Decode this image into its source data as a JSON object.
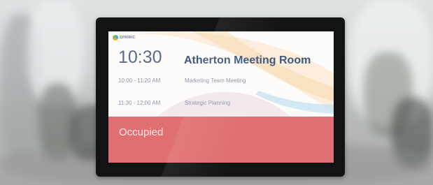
{
  "logo": {
    "text": "SPRIRIC",
    "icon": "pinwheel-logo-icon"
  },
  "clock": "10:30",
  "room_name": "Atherton Meeting Room",
  "meetings": [
    {
      "time": "10:00 - 11:20 AM",
      "title": "Marketing Team Meeting"
    },
    {
      "time": "11:30 - 12:00 AM",
      "title": "Strategic Planning"
    }
  ],
  "status": "Occupied",
  "colors": {
    "status_bar": "#e06f71",
    "room_title": "#3d5a80",
    "clock": "#5b6b83",
    "device_frame": "#121314"
  }
}
